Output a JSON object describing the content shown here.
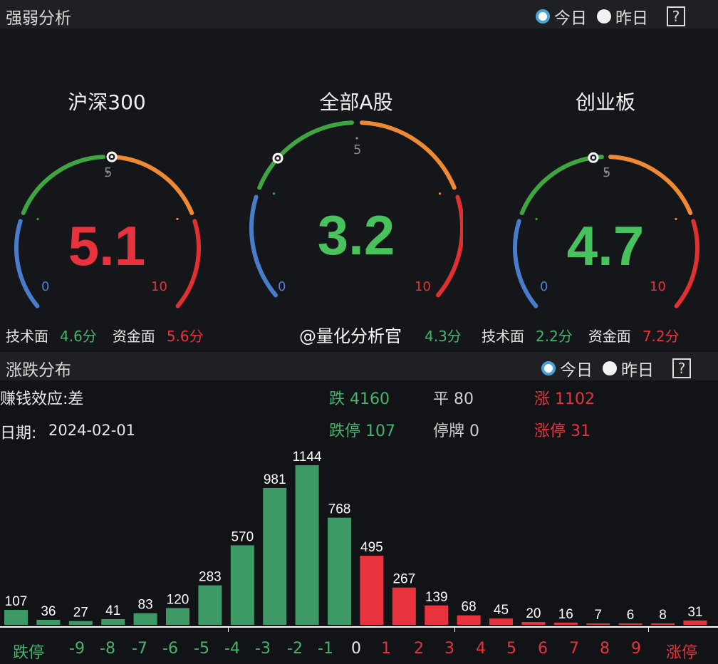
{
  "strength": {
    "title": "强弱分析",
    "radio_today": "今日",
    "radio_yesterday": "昨日",
    "help": "?"
  },
  "gauges": [
    {
      "title": "沪深300",
      "value": "5.1",
      "value_color": "#e8333f",
      "mid": "5",
      "min": "0",
      "max": "10",
      "pointer": 5.1
    },
    {
      "title": "全部A股",
      "value": "3.2",
      "value_color": "#47c25c",
      "mid": "5",
      "min": "0",
      "max": "10",
      "pointer": 3.2
    },
    {
      "title": "创业板",
      "value": "4.7",
      "value_color": "#47c25c",
      "mid": "5",
      "min": "0",
      "max": "10",
      "pointer": 4.7
    }
  ],
  "scores": {
    "g1_tech_label": "技术面",
    "g1_tech_val": "4.6分",
    "g1_fund_label": "资金面",
    "g1_fund_val": "5.6分",
    "g2_partial_val": "4.3分",
    "g3_tech_label": "技术面",
    "g3_tech_val": "2.2分",
    "g3_fund_label": "资金面",
    "g3_fund_val": "7.2分"
  },
  "watermark": "@量化分析官",
  "distribution": {
    "title": "涨跌分布",
    "radio_today": "今日",
    "radio_yesterday": "昨日",
    "help": "?",
    "effect": "赚钱效应:差",
    "date_label": "日期:",
    "date": "2024-02-01",
    "down": "跌 4160",
    "flat": "平 80",
    "up": "涨 1102",
    "limit_down": "跌停 107",
    "halted": "停牌 0",
    "limit_up": "涨停 31"
  },
  "chart_data": {
    "type": "bar",
    "categories": [
      "跌停",
      "-9",
      "-8",
      "-7",
      "-6",
      "-5",
      "-4",
      "-3",
      "-2",
      "-1",
      "0",
      "1",
      "2",
      "3",
      "4",
      "5",
      "6",
      "7",
      "8",
      "9",
      "涨停"
    ],
    "values": [
      107,
      36,
      27,
      41,
      83,
      120,
      283,
      570,
      981,
      1144,
      768,
      495,
      267,
      139,
      68,
      45,
      20,
      16,
      7,
      6,
      8,
      31
    ],
    "bar_values": [
      107,
      36,
      27,
      41,
      83,
      120,
      283,
      570,
      981,
      1144,
      768,
      495,
      267,
      139,
      68,
      45,
      20,
      16,
      7,
      6,
      8,
      31
    ],
    "green": "#3d9a65",
    "red": "#e8333f"
  }
}
